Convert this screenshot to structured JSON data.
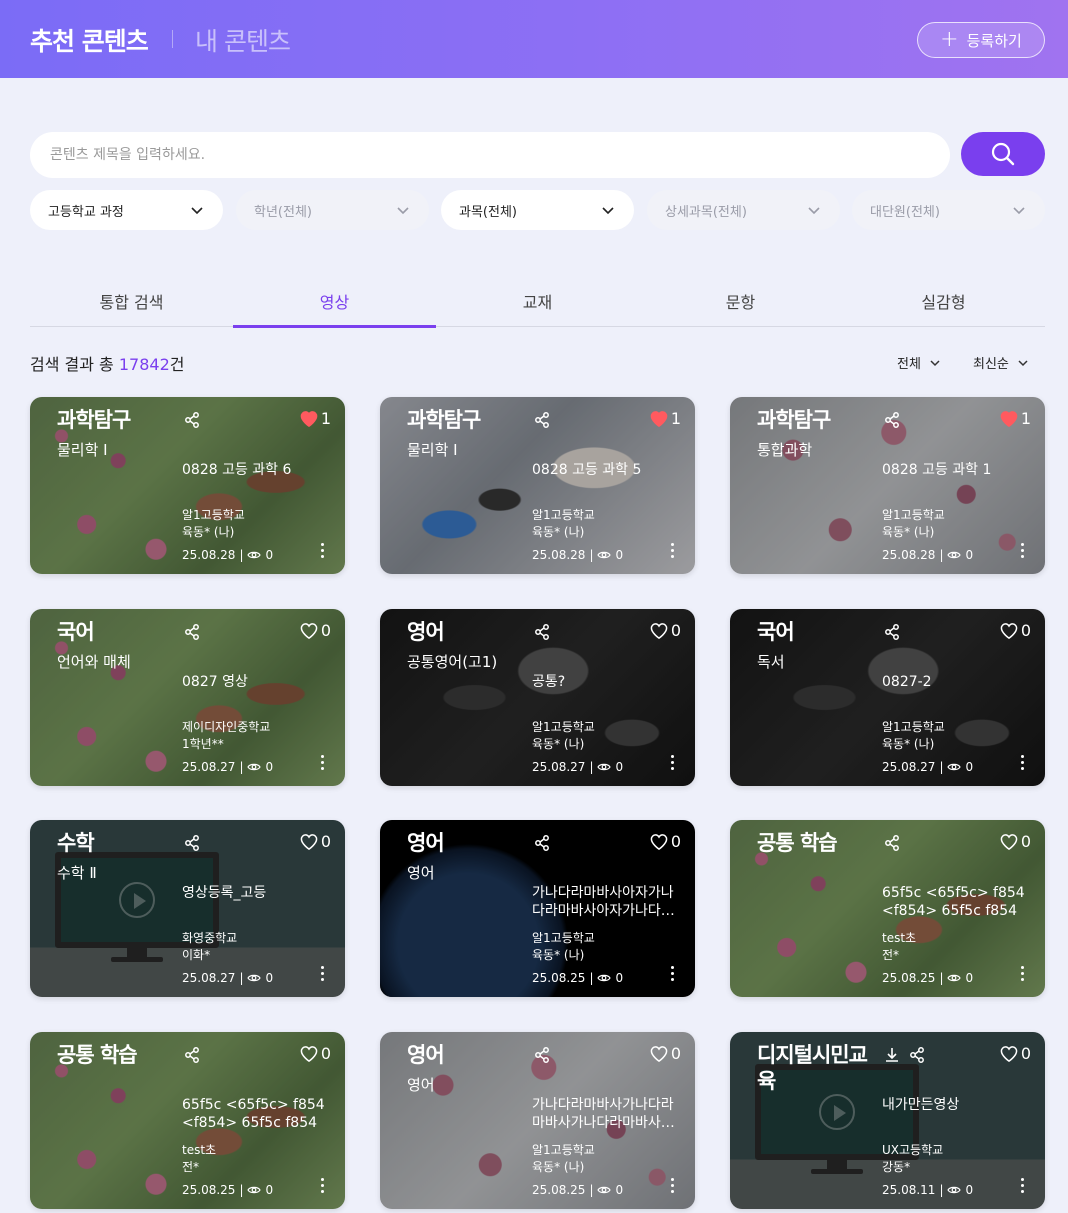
{
  "header": {
    "tab_recommended": "추천 콘텐츠",
    "tab_mine": "내 콘텐츠",
    "register_label": "등록하기"
  },
  "search": {
    "placeholder": "콘텐츠 제목을 입력하세요."
  },
  "filters": [
    {
      "label": "고등학교 과정",
      "enabled": true
    },
    {
      "label": "학년(전체)",
      "enabled": false
    },
    {
      "label": "과목(전체)",
      "enabled": true
    },
    {
      "label": "상세과목(전체)",
      "enabled": false
    },
    {
      "label": "대단원(전체)",
      "enabled": false
    }
  ],
  "category_tabs": [
    "통합 검색",
    "영상",
    "교재",
    "문항",
    "실감형"
  ],
  "active_tab": "영상",
  "result": {
    "prefix": "검색 결과 총 ",
    "count": "17842",
    "suffix": "건"
  },
  "sort": {
    "filter_label": "전체",
    "order_label": "최신순"
  },
  "cards": [
    {
      "subject": "과학탐구",
      "sub": "물리학 Ⅰ",
      "title": "0828 고등 과학 6",
      "school": "알1고등학교",
      "author": "육동* (나)",
      "date": "25.08.28",
      "views": "0",
      "likes": "1",
      "liked": true,
      "bg": "flower",
      "download": false
    },
    {
      "subject": "과학탐구",
      "sub": "물리학 Ⅰ",
      "title": "0828 고등 과학 5",
      "school": "알1고등학교",
      "author": "육동* (나)",
      "date": "25.08.28",
      "views": "0",
      "likes": "1",
      "liked": true,
      "bg": "lab",
      "download": false
    },
    {
      "subject": "과학탐구",
      "sub": "통합과학",
      "title": "0828 고등 과학 1",
      "school": "알1고등학교",
      "author": "육동* (나)",
      "date": "25.08.28",
      "views": "0",
      "likes": "1",
      "liked": true,
      "bg": "blossom",
      "download": false
    },
    {
      "subject": "국어",
      "sub": "언어와 매체",
      "title": "0827 영상",
      "school": "제이디자인중학교",
      "author": "1학년**",
      "date": "25.08.27",
      "views": "0",
      "likes": "0",
      "liked": false,
      "bg": "flower",
      "download": false
    },
    {
      "subject": "영어",
      "sub": "공통영어(고1)",
      "title": "공통?",
      "school": "알1고등학교",
      "author": "육동* (나)",
      "date": "25.08.27",
      "views": "0",
      "likes": "0",
      "liked": false,
      "bg": "darklab",
      "download": false
    },
    {
      "subject": "국어",
      "sub": "독서",
      "title": "0827-2",
      "school": "알1고등학교",
      "author": "육동* (나)",
      "date": "25.08.27",
      "views": "0",
      "likes": "0",
      "liked": false,
      "bg": "darklab",
      "download": false
    },
    {
      "subject": "수학",
      "sub": "수학 Ⅱ",
      "title": "영상등록_고등",
      "school": "화영중학교",
      "author": "이화*",
      "date": "25.08.27",
      "views": "0",
      "likes": "0",
      "liked": false,
      "bg": "monitor",
      "download": false
    },
    {
      "subject": "영어",
      "sub": "영어",
      "title": "가나다라마바사아자가나다라마바사아자가나다…",
      "school": "알1고등학교",
      "author": "육동* (나)",
      "date": "25.08.25",
      "views": "0",
      "likes": "0",
      "liked": false,
      "bg": "earth",
      "download": false
    },
    {
      "subject": "공통 학습",
      "sub": "",
      "title": "65f5c <65f5c> f854 <f854> 65f5c f854 6…",
      "school": "test초",
      "author": "전*",
      "date": "25.08.25",
      "views": "0",
      "likes": "0",
      "liked": false,
      "bg": "flower",
      "download": false
    },
    {
      "subject": "공통 학습",
      "sub": "",
      "title": "65f5c <65f5c> f854 <f854> 65f5c f854 6…",
      "school": "test초",
      "author": "전*",
      "date": "25.08.25",
      "views": "0",
      "likes": "0",
      "liked": false,
      "bg": "flower",
      "download": false
    },
    {
      "subject": "영어",
      "sub": "영어",
      "title": "가나다라마바사가나다라마바사가나다라마바사…",
      "school": "알1고등학교",
      "author": "육동* (나)",
      "date": "25.08.25",
      "views": "0",
      "likes": "0",
      "liked": false,
      "bg": "blossom",
      "download": false
    },
    {
      "subject": "디지털시민교육",
      "sub": "",
      "title": "내가만든영상",
      "school": "UX고등학교",
      "author": "강동*",
      "date": "25.08.11",
      "views": "0",
      "likes": "0",
      "liked": false,
      "bg": "monitor",
      "download": true
    }
  ],
  "colors": {
    "accent": "#7a3fee",
    "header_start": "#7b6cf6",
    "header_end": "#a073f0",
    "like_red": "#ff5a5f"
  },
  "icons": {
    "search": "search-icon",
    "share": "share-icon",
    "heart": "heart-icon",
    "eye": "eye-icon",
    "more": "more-vertical-icon",
    "download": "download-icon",
    "chevron": "chevron-down-icon",
    "plus": "plus-icon"
  }
}
